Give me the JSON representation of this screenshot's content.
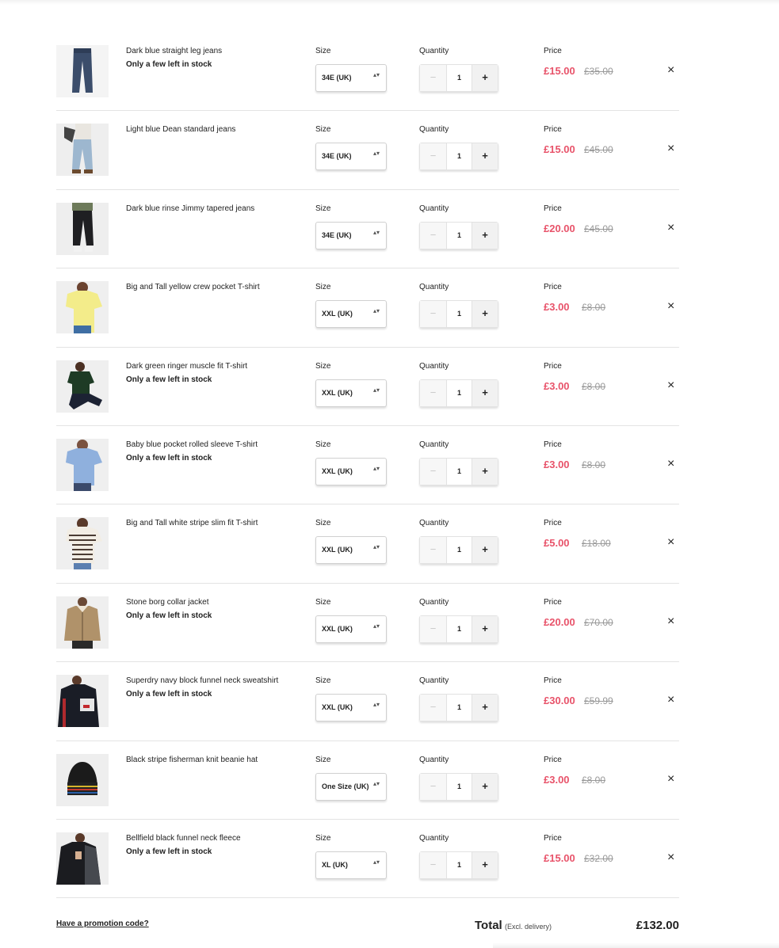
{
  "labels": {
    "size": "Size",
    "quantity": "Quantity",
    "price": "Price",
    "stock_warning": "Only a few left in stock",
    "minus": "−",
    "plus": "+",
    "remove": "×",
    "select_chevron": "▴▾"
  },
  "items": [
    {
      "name": "Dark blue straight leg jeans",
      "low_stock": true,
      "size": "34E (UK)",
      "quantity": "1",
      "price_now": "£15.00",
      "price_was": "£35.00",
      "image": "jeans-dark-blue"
    },
    {
      "name": "Light blue Dean standard jeans",
      "low_stock": false,
      "size": "34E (UK)",
      "quantity": "1",
      "price_now": "£15.00",
      "price_was": "£45.00",
      "image": "jeans-light-blue"
    },
    {
      "name": "Dark blue rinse Jimmy tapered jeans",
      "low_stock": false,
      "size": "34E (UK)",
      "quantity": "1",
      "price_now": "£20.00",
      "price_was": "£45.00",
      "image": "jeans-black"
    },
    {
      "name": "Big and Tall yellow crew pocket T-shirt",
      "low_stock": false,
      "size": "XXL (UK)",
      "quantity": "1",
      "price_now": "£3.00",
      "price_was": "£8.00",
      "image": "tshirt-yellow"
    },
    {
      "name": "Dark green ringer muscle fit T-shirt",
      "low_stock": true,
      "size": "XXL (UK)",
      "quantity": "1",
      "price_now": "£3.00",
      "price_was": "£8.00",
      "image": "tshirt-green"
    },
    {
      "name": "Baby blue pocket rolled sleeve T-shirt",
      "low_stock": true,
      "size": "XXL (UK)",
      "quantity": "1",
      "price_now": "£3.00",
      "price_was": "£8.00",
      "image": "tshirt-baby-blue"
    },
    {
      "name": "Big and Tall white stripe slim fit T-shirt",
      "low_stock": false,
      "size": "XXL (UK)",
      "quantity": "1",
      "price_now": "£5.00",
      "price_was": "£18.00",
      "image": "tshirt-stripe"
    },
    {
      "name": "Stone borg collar jacket",
      "low_stock": true,
      "size": "XXL (UK)",
      "quantity": "1",
      "price_now": "£20.00",
      "price_was": "£70.00",
      "image": "jacket-stone"
    },
    {
      "name": "Superdry navy block funnel neck sweatshirt",
      "low_stock": true,
      "size": "XXL (UK)",
      "quantity": "1",
      "price_now": "£30.00",
      "price_was": "£59.99",
      "image": "sweatshirt-navy"
    },
    {
      "name": "Black stripe fisherman knit beanie hat",
      "low_stock": false,
      "size": "One Size (UK)",
      "quantity": "1",
      "price_now": "£3.00",
      "price_was": "£8.00",
      "image": "beanie-black"
    },
    {
      "name": "Bellfield black funnel neck fleece",
      "low_stock": true,
      "size": "XL (UK)",
      "quantity": "1",
      "price_now": "£15.00",
      "price_was": "£32.00",
      "image": "fleece-black"
    }
  ],
  "footer": {
    "promo_link": "Have a promotion code?",
    "total_label": "Total",
    "total_note": "(Excl. delivery)",
    "total_value": "£132.00"
  },
  "colors": {
    "sale_price": "#e8536a",
    "was_price": "#999999",
    "divider": "#e3e3e3"
  }
}
